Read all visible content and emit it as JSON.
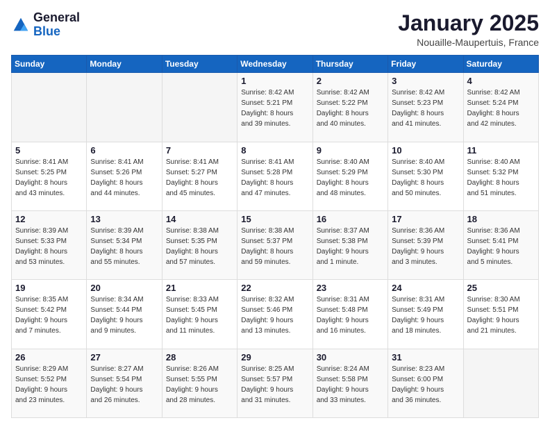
{
  "logo": {
    "line1": "General",
    "line2": "Blue"
  },
  "header": {
    "month": "January 2025",
    "location": "Nouaille-Maupertuis, France"
  },
  "weekdays": [
    "Sunday",
    "Monday",
    "Tuesday",
    "Wednesday",
    "Thursday",
    "Friday",
    "Saturday"
  ],
  "weeks": [
    [
      {
        "day": "",
        "info": ""
      },
      {
        "day": "",
        "info": ""
      },
      {
        "day": "",
        "info": ""
      },
      {
        "day": "1",
        "info": "Sunrise: 8:42 AM\nSunset: 5:21 PM\nDaylight: 8 hours\nand 39 minutes."
      },
      {
        "day": "2",
        "info": "Sunrise: 8:42 AM\nSunset: 5:22 PM\nDaylight: 8 hours\nand 40 minutes."
      },
      {
        "day": "3",
        "info": "Sunrise: 8:42 AM\nSunset: 5:23 PM\nDaylight: 8 hours\nand 41 minutes."
      },
      {
        "day": "4",
        "info": "Sunrise: 8:42 AM\nSunset: 5:24 PM\nDaylight: 8 hours\nand 42 minutes."
      }
    ],
    [
      {
        "day": "5",
        "info": "Sunrise: 8:41 AM\nSunset: 5:25 PM\nDaylight: 8 hours\nand 43 minutes."
      },
      {
        "day": "6",
        "info": "Sunrise: 8:41 AM\nSunset: 5:26 PM\nDaylight: 8 hours\nand 44 minutes."
      },
      {
        "day": "7",
        "info": "Sunrise: 8:41 AM\nSunset: 5:27 PM\nDaylight: 8 hours\nand 45 minutes."
      },
      {
        "day": "8",
        "info": "Sunrise: 8:41 AM\nSunset: 5:28 PM\nDaylight: 8 hours\nand 47 minutes."
      },
      {
        "day": "9",
        "info": "Sunrise: 8:40 AM\nSunset: 5:29 PM\nDaylight: 8 hours\nand 48 minutes."
      },
      {
        "day": "10",
        "info": "Sunrise: 8:40 AM\nSunset: 5:30 PM\nDaylight: 8 hours\nand 50 minutes."
      },
      {
        "day": "11",
        "info": "Sunrise: 8:40 AM\nSunset: 5:32 PM\nDaylight: 8 hours\nand 51 minutes."
      }
    ],
    [
      {
        "day": "12",
        "info": "Sunrise: 8:39 AM\nSunset: 5:33 PM\nDaylight: 8 hours\nand 53 minutes."
      },
      {
        "day": "13",
        "info": "Sunrise: 8:39 AM\nSunset: 5:34 PM\nDaylight: 8 hours\nand 55 minutes."
      },
      {
        "day": "14",
        "info": "Sunrise: 8:38 AM\nSunset: 5:35 PM\nDaylight: 8 hours\nand 57 minutes."
      },
      {
        "day": "15",
        "info": "Sunrise: 8:38 AM\nSunset: 5:37 PM\nDaylight: 8 hours\nand 59 minutes."
      },
      {
        "day": "16",
        "info": "Sunrise: 8:37 AM\nSunset: 5:38 PM\nDaylight: 9 hours\nand 1 minute."
      },
      {
        "day": "17",
        "info": "Sunrise: 8:36 AM\nSunset: 5:39 PM\nDaylight: 9 hours\nand 3 minutes."
      },
      {
        "day": "18",
        "info": "Sunrise: 8:36 AM\nSunset: 5:41 PM\nDaylight: 9 hours\nand 5 minutes."
      }
    ],
    [
      {
        "day": "19",
        "info": "Sunrise: 8:35 AM\nSunset: 5:42 PM\nDaylight: 9 hours\nand 7 minutes."
      },
      {
        "day": "20",
        "info": "Sunrise: 8:34 AM\nSunset: 5:44 PM\nDaylight: 9 hours\nand 9 minutes."
      },
      {
        "day": "21",
        "info": "Sunrise: 8:33 AM\nSunset: 5:45 PM\nDaylight: 9 hours\nand 11 minutes."
      },
      {
        "day": "22",
        "info": "Sunrise: 8:32 AM\nSunset: 5:46 PM\nDaylight: 9 hours\nand 13 minutes."
      },
      {
        "day": "23",
        "info": "Sunrise: 8:31 AM\nSunset: 5:48 PM\nDaylight: 9 hours\nand 16 minutes."
      },
      {
        "day": "24",
        "info": "Sunrise: 8:31 AM\nSunset: 5:49 PM\nDaylight: 9 hours\nand 18 minutes."
      },
      {
        "day": "25",
        "info": "Sunrise: 8:30 AM\nSunset: 5:51 PM\nDaylight: 9 hours\nand 21 minutes."
      }
    ],
    [
      {
        "day": "26",
        "info": "Sunrise: 8:29 AM\nSunset: 5:52 PM\nDaylight: 9 hours\nand 23 minutes."
      },
      {
        "day": "27",
        "info": "Sunrise: 8:27 AM\nSunset: 5:54 PM\nDaylight: 9 hours\nand 26 minutes."
      },
      {
        "day": "28",
        "info": "Sunrise: 8:26 AM\nSunset: 5:55 PM\nDaylight: 9 hours\nand 28 minutes."
      },
      {
        "day": "29",
        "info": "Sunrise: 8:25 AM\nSunset: 5:57 PM\nDaylight: 9 hours\nand 31 minutes."
      },
      {
        "day": "30",
        "info": "Sunrise: 8:24 AM\nSunset: 5:58 PM\nDaylight: 9 hours\nand 33 minutes."
      },
      {
        "day": "31",
        "info": "Sunrise: 8:23 AM\nSunset: 6:00 PM\nDaylight: 9 hours\nand 36 minutes."
      },
      {
        "day": "",
        "info": ""
      }
    ]
  ]
}
